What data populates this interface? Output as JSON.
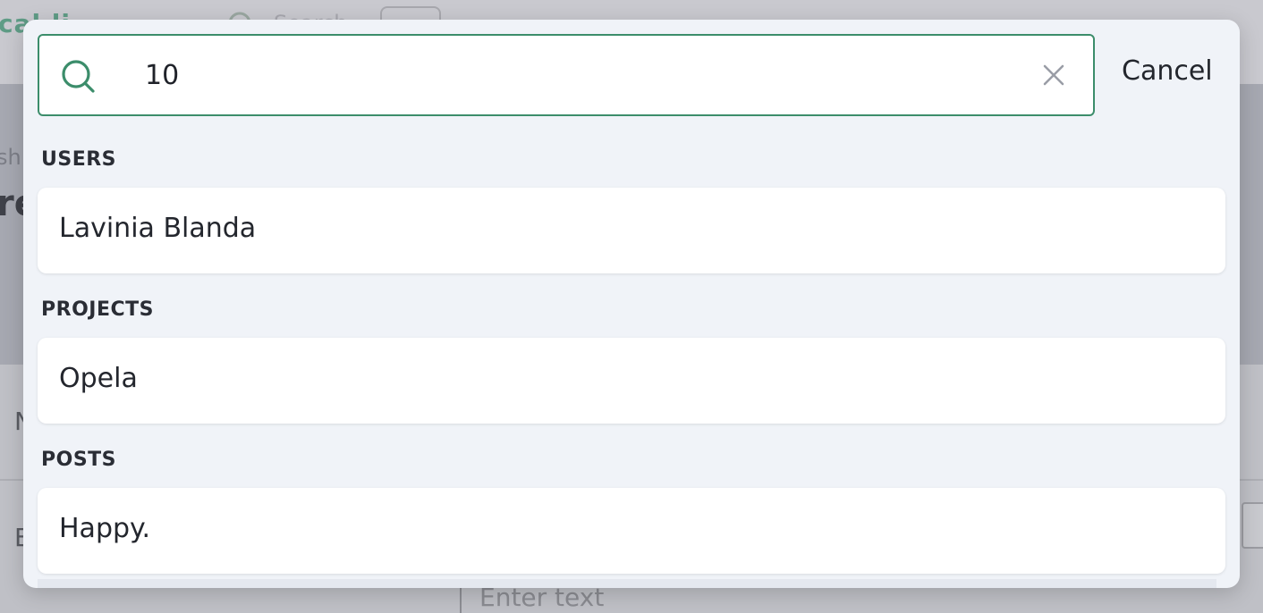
{
  "background": {
    "logo_text": "cal.li",
    "search_placeholder": "Search",
    "breadcrumb": "shl",
    "title": "re",
    "field_n": "N",
    "field_e": "E",
    "editor_placeholder": "Enter text"
  },
  "search": {
    "query": "10",
    "cancel_label": "Cancel"
  },
  "sections": {
    "users": {
      "label": "USERS",
      "items": [
        "Lavinia Blanda"
      ]
    },
    "projects": {
      "label": "PROJECTS",
      "items": [
        "Opela"
      ]
    },
    "posts": {
      "label": "POSTS",
      "items": [
        "Happy."
      ]
    }
  },
  "colors": {
    "accent": "#3c8d6b",
    "modal_bg": "#f0f3f8",
    "overlay": "#bcbcc2"
  }
}
